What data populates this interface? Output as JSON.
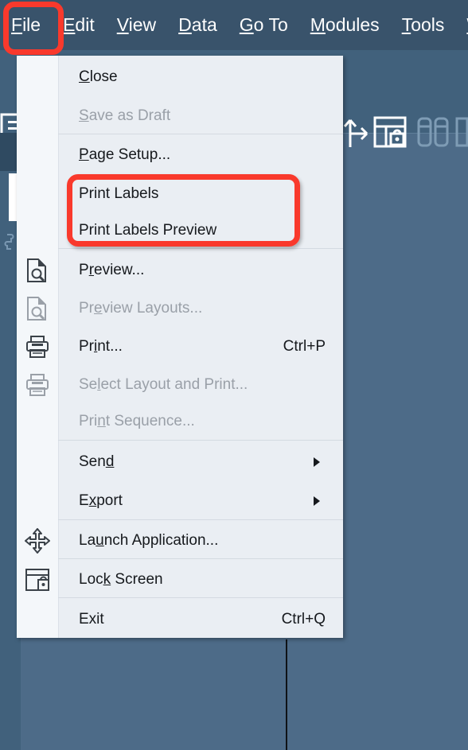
{
  "app": {
    "background_color": "#4d6b88",
    "menubar_color": "#39536b",
    "menu_background": "#eaeef3",
    "highlight_color": "#f9392c"
  },
  "menubar": {
    "items": [
      {
        "label": "File",
        "mnemonic": "F",
        "active": true
      },
      {
        "label": "Edit",
        "mnemonic": "E",
        "active": false
      },
      {
        "label": "View",
        "mnemonic": "V",
        "active": false
      },
      {
        "label": "Data",
        "mnemonic": "D",
        "active": false
      },
      {
        "label": "Go To",
        "mnemonic": "G",
        "active": false
      },
      {
        "label": "Modules",
        "mnemonic": "M",
        "active": false
      },
      {
        "label": "Tools",
        "mnemonic": "T",
        "active": false
      },
      {
        "label": "Window",
        "mnemonic": "W",
        "active": false
      }
    ]
  },
  "toolbar": {
    "icons": [
      {
        "name": "layout-list-icon",
        "enabled": true
      },
      {
        "name": "share-arrow-icon",
        "enabled": true
      },
      {
        "name": "window-lock-icon",
        "enabled": true
      },
      {
        "name": "compare-columns-icon",
        "enabled": false
      },
      {
        "name": "panel-split-icon",
        "enabled": false
      }
    ]
  },
  "left_rail": {
    "icons": [
      {
        "name": "puzzle-piece-icon",
        "enabled": true
      }
    ]
  },
  "file_menu": {
    "items": [
      {
        "id": "close",
        "label": "Close",
        "mnemonic": "C",
        "pre": "",
        "post": "lose",
        "accel": "",
        "icon": "",
        "enabled": true,
        "submenu": false
      },
      {
        "id": "save-as-draft",
        "label": "Save as Draft",
        "mnemonic": "S",
        "pre": "",
        "post": "ave as Draft",
        "accel": "",
        "icon": "",
        "enabled": false,
        "submenu": false
      },
      {
        "id": "page-setup",
        "label": "Page Setup...",
        "mnemonic": "P",
        "pre": "",
        "post": "age Setup...",
        "accel": "",
        "icon": "",
        "enabled": true,
        "submenu": false
      },
      {
        "id": "print-labels",
        "label": "Print Labels",
        "mnemonic": "",
        "pre": "Print Labels",
        "post": "",
        "accel": "",
        "icon": "",
        "enabled": true,
        "submenu": false
      },
      {
        "id": "print-labels-preview",
        "label": "Print Labels Preview",
        "mnemonic": "",
        "pre": "Print Labels Preview",
        "post": "",
        "accel": "",
        "icon": "",
        "enabled": true,
        "submenu": false
      },
      {
        "id": "preview",
        "label": "Preview...",
        "mnemonic": "r",
        "pre": "P",
        "post": "eview...",
        "accel": "",
        "icon": "document-preview-icon",
        "enabled": true,
        "submenu": false
      },
      {
        "id": "preview-layouts",
        "label": "Preview Layouts...",
        "mnemonic": "e",
        "pre": "Pr",
        "post": "view Layouts...",
        "accel": "",
        "icon": "document-preview-icon",
        "enabled": false,
        "submenu": false
      },
      {
        "id": "print",
        "label": "Print...",
        "mnemonic": "i",
        "pre": "Pr",
        "post": "nt...",
        "accel": "Ctrl+P",
        "icon": "printer-icon",
        "enabled": true,
        "submenu": false
      },
      {
        "id": "select-layout-and-print",
        "label": "Select Layout and Print...",
        "mnemonic": "l",
        "pre": "Se",
        "post": "ect Layout and Print...",
        "accel": "",
        "icon": "printer-icon",
        "enabled": false,
        "submenu": false
      },
      {
        "id": "print-sequence",
        "label": "Print Sequence...",
        "mnemonic": "n",
        "pre": "Pri",
        "post": "t Sequence...",
        "accel": "",
        "icon": "",
        "enabled": false,
        "submenu": false
      },
      {
        "id": "send",
        "label": "Send",
        "mnemonic": "d",
        "pre": "Sen",
        "post": "",
        "accel": "",
        "icon": "",
        "enabled": true,
        "submenu": true
      },
      {
        "id": "export",
        "label": "Export",
        "mnemonic": "x",
        "pre": "E",
        "post": "port",
        "accel": "",
        "icon": "",
        "enabled": true,
        "submenu": true
      },
      {
        "id": "launch-application",
        "label": "Launch Application...",
        "mnemonic": "u",
        "pre": "La",
        "post": "nch Application...",
        "accel": "",
        "icon": "move-arrows-icon",
        "enabled": true,
        "submenu": false
      },
      {
        "id": "lock-screen",
        "label": "Lock Screen",
        "mnemonic": "k",
        "pre": "Loc",
        "post": " Screen",
        "accel": "",
        "icon": "window-lock-icon",
        "enabled": true,
        "submenu": false
      },
      {
        "id": "exit",
        "label": "Exit",
        "mnemonic": "",
        "pre": "Exit",
        "post": "",
        "accel": "Ctrl+Q",
        "icon": "",
        "enabled": true,
        "submenu": false
      }
    ]
  },
  "annotations": [
    {
      "name": "file-menu-highlight",
      "target": "File"
    },
    {
      "name": "print-labels-highlight",
      "target": "Print Labels / Print Labels Preview"
    }
  ]
}
